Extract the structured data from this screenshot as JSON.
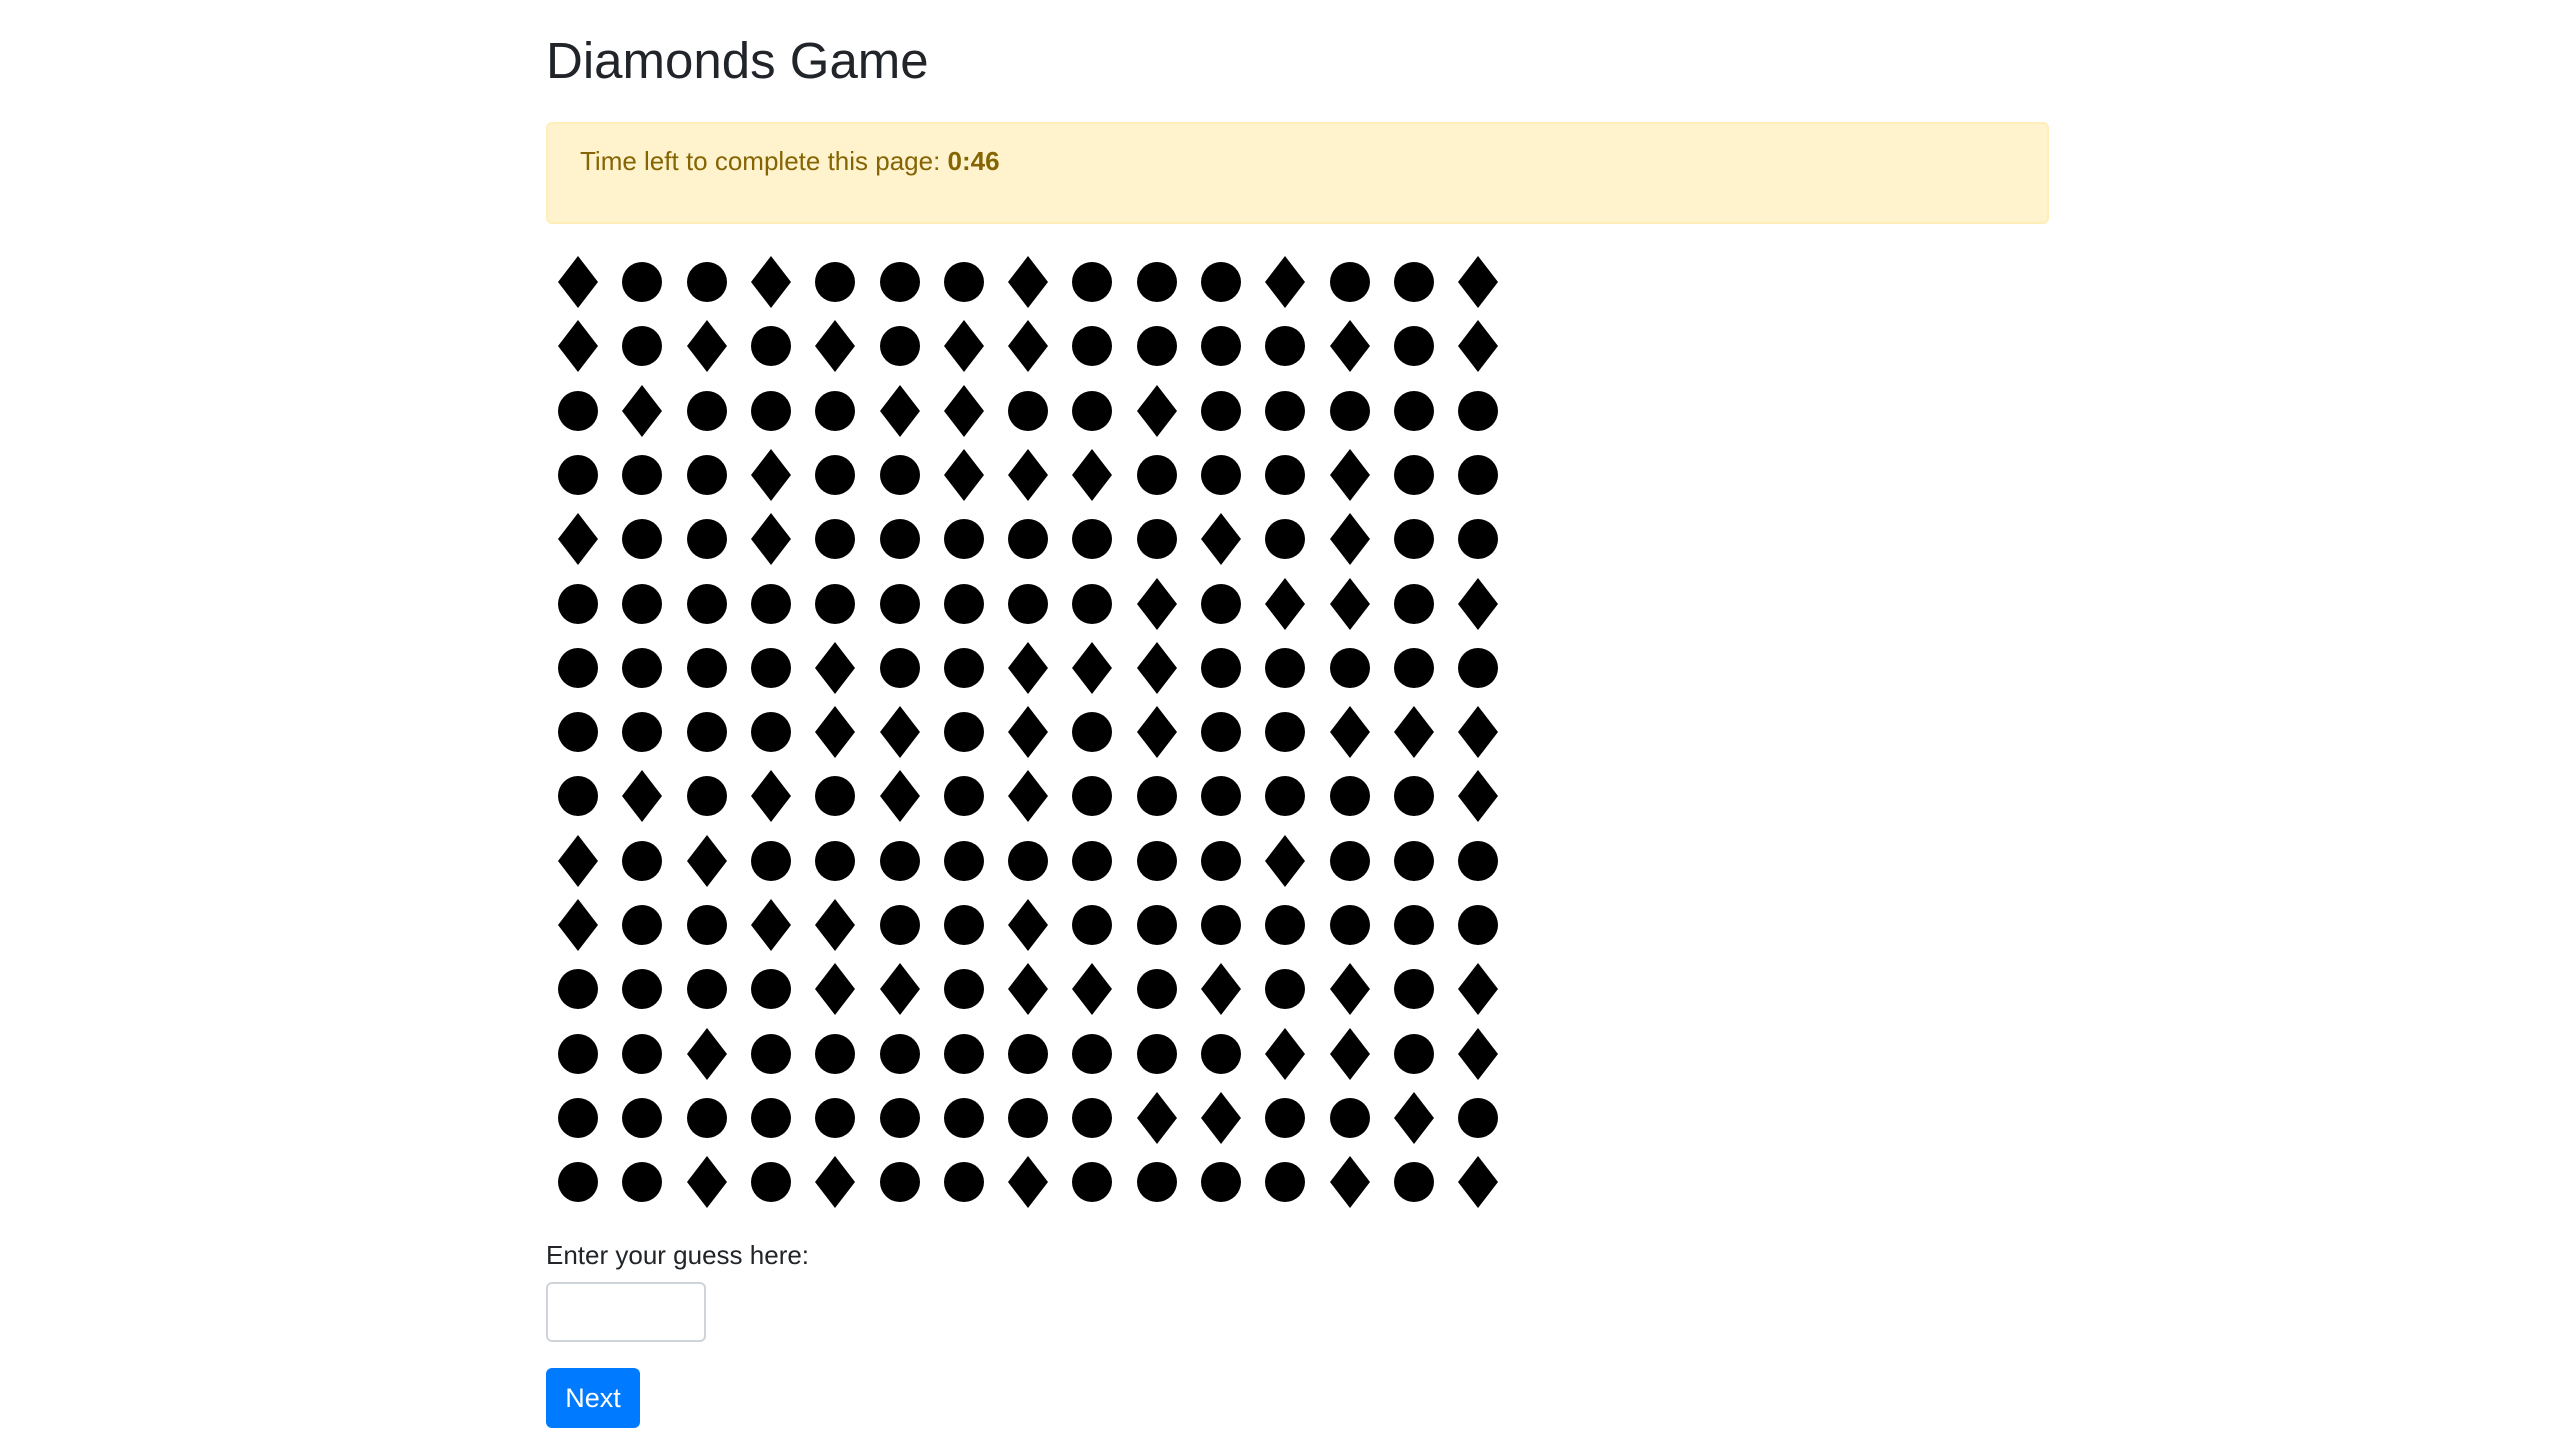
{
  "page": {
    "title": "Diamonds Game"
  },
  "timer": {
    "prefix": "Time left to complete this page: ",
    "value": "0:46"
  },
  "grid": {
    "shape_color": "#000000",
    "icons": {
      "D": "diamond-icon",
      "C": "circle-icon"
    },
    "rows": [
      "DCCDCCCDCCCDCCD",
      "DCDCDCDDCCCCDCD",
      "CDCCCDDCCDCCCCC",
      "CCCDCCDDDCCCDCC",
      "DCCDCCCCCCDCDCC",
      "CCCCCCCCCDCDDCD",
      "CCCCDCCDDDCCCCC",
      "CCCCDDCDCDCCDDD",
      "CDCDCDCDCCCCCCD",
      "DCDCCCCCCCCDCCC",
      "DCCDDCCDCCCCCCC",
      "CCCCDDCDDCDCDCD",
      "CCDCCCCCCCCDDCD",
      "CCCCCCCCCDDCCDC",
      "CCDCDCCDCCCCDCD"
    ]
  },
  "guess": {
    "label": "Enter your guess here:",
    "value": "",
    "placeholder": ""
  },
  "actions": {
    "next_label": "Next",
    "next_color": "#007bff"
  },
  "colors": {
    "alert_background": "#fff3cd",
    "alert_text": "#856404"
  }
}
